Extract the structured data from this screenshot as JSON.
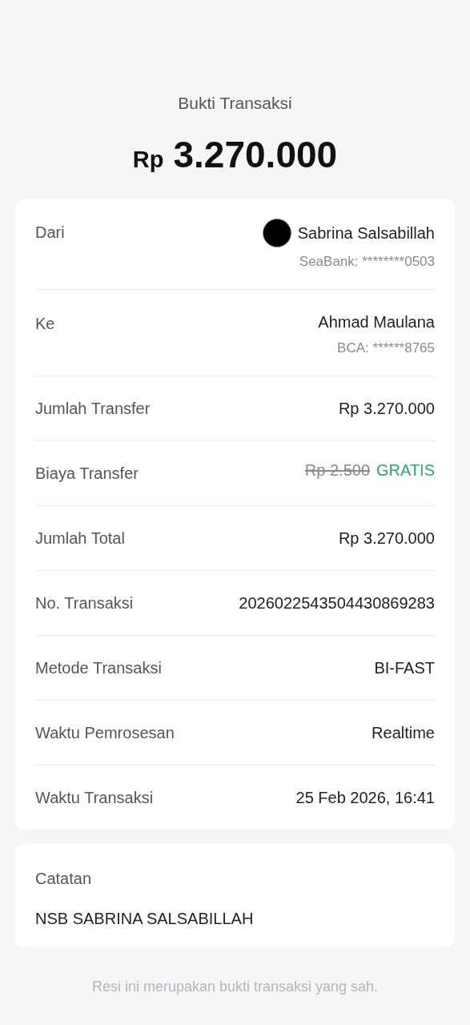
{
  "header": {
    "title": "Bukti Transaksi",
    "currency": "Rp",
    "amount": "3.270.000"
  },
  "details": [
    {
      "kind": "party",
      "label": "Dari",
      "avatar": true,
      "name": "Sabrina Salsabillah",
      "account": "SeaBank: ********0503"
    },
    {
      "kind": "party",
      "label": "Ke",
      "avatar": false,
      "name": "Ahmad Maulana",
      "account": "BCA: ******8765"
    },
    {
      "kind": "plain",
      "label": "Jumlah Transfer",
      "value": "Rp 3.270.000"
    },
    {
      "kind": "fee",
      "label": "Biaya Transfer",
      "original": "Rp 2.500",
      "value": "GRATIS"
    },
    {
      "kind": "plain",
      "label": "Jumlah Total",
      "value": "Rp 3.270.000"
    },
    {
      "kind": "plain",
      "label": "No. Transaksi",
      "value": "2026022543504430869283"
    },
    {
      "kind": "plain",
      "label": "Metode Transaksi",
      "value": "BI-FAST"
    },
    {
      "kind": "plain",
      "label": "Waktu Pemrosesan",
      "value": "Realtime"
    },
    {
      "kind": "plain",
      "label": "Waktu Transaksi",
      "value": "25 Feb 2026, 16:41"
    }
  ],
  "notes": {
    "label": "Catatan",
    "text": "NSB SABRINA SALSABILLAH"
  },
  "footer": "Resi ini merupakan bukti transaksi yang sah."
}
